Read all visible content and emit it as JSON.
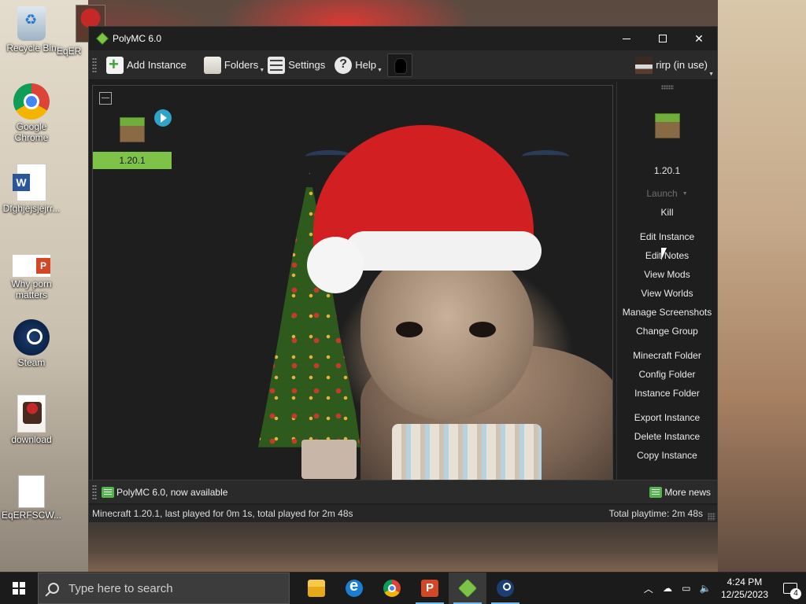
{
  "desktop": {
    "icons": [
      {
        "label": "Recycle Bin"
      },
      {
        "label": "EqER"
      },
      {
        "label": "Google Chrome"
      },
      {
        "label": "Dfghjejsjejrr..."
      },
      {
        "label": "Why porn matters"
      },
      {
        "label": "Steam"
      },
      {
        "label": "download"
      },
      {
        "label": "EqERFSCW..."
      }
    ]
  },
  "window": {
    "title": "PolyMC 6.0"
  },
  "toolbar": {
    "add_instance": "Add Instance",
    "folders": "Folders",
    "settings": "Settings",
    "help": "Help",
    "account": "rirp (in use)"
  },
  "instances": [
    {
      "name": "1.20.1",
      "icon": "grass-block-icon",
      "state": "running"
    }
  ],
  "side_panel": {
    "instance_name": "1.20.1",
    "launch": "Launch",
    "kill": "Kill",
    "group1": [
      "Edit Instance",
      "Edit Notes",
      "View Mods",
      "View Worlds",
      "Manage Screenshots",
      "Change Group"
    ],
    "group2": [
      "Minecraft Folder",
      "Config Folder",
      "Instance Folder"
    ],
    "group3": [
      "Export Instance",
      "Delete Instance",
      "Copy Instance"
    ]
  },
  "news": {
    "headline": "PolyMC 6.0, now available",
    "more": "More news"
  },
  "status": {
    "left": "Minecraft 1.20.1, last played for 0m 1s, total played for 2m 48s",
    "right": "Total playtime: 2m 48s"
  },
  "taskbar": {
    "search_placeholder": "Type here to search",
    "time": "4:24 PM",
    "date": "12/25/2023",
    "notification_count": "4"
  },
  "colors": {
    "instance_selected": "#7cc347",
    "window_bg": "#1e1e1e",
    "taskbar_bg": "#1b1b1b"
  }
}
